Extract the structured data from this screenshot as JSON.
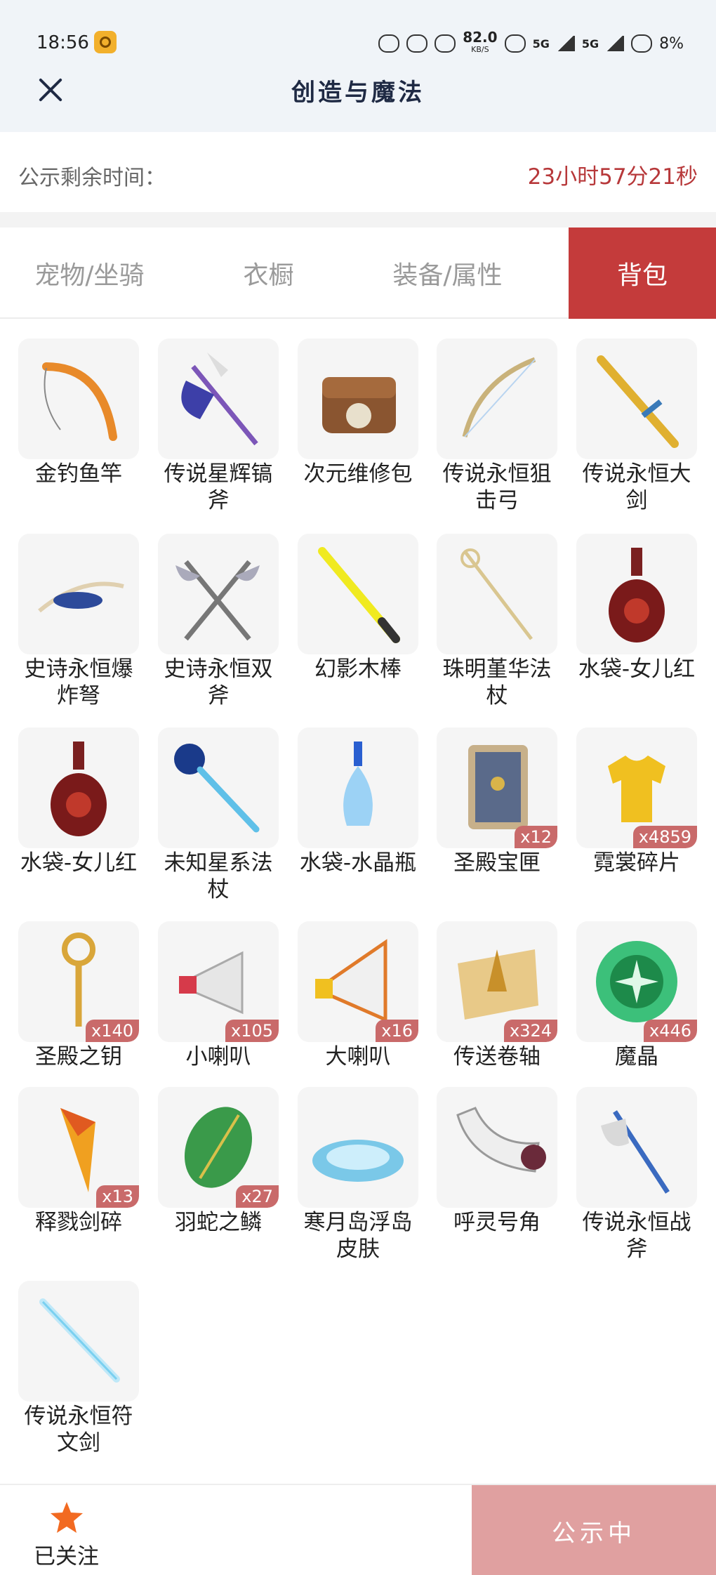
{
  "status_bar": {
    "time": "18:56",
    "speed": "82.0",
    "speed_unit": "KB/S",
    "net1": "5G",
    "net2": "5G",
    "battery": "8%"
  },
  "header": {
    "title": "创造与魔法",
    "close_icon": "close-icon"
  },
  "notice": {
    "label": "公示剩余时间：",
    "remaining": "23小时57分21秒"
  },
  "tabs": [
    {
      "label": "宠物/坐骑",
      "active": false
    },
    {
      "label": "衣橱",
      "active": false
    },
    {
      "label": "装备/属性",
      "active": false
    },
    {
      "label": "背包",
      "active": true
    }
  ],
  "items": [
    {
      "name": "金钓鱼竿",
      "badge": "",
      "icon": "fishing-rod-icon"
    },
    {
      "name": "传说星辉镐斧",
      "badge": "",
      "icon": "axe-icon"
    },
    {
      "name": "次元维修包",
      "badge": "",
      "icon": "repair-bag-icon"
    },
    {
      "name": "传说永恒狙击弓",
      "badge": "",
      "icon": "bow-icon"
    },
    {
      "name": "传说永恒大剑",
      "badge": "",
      "icon": "sword-icon"
    },
    {
      "name": "史诗永恒爆炸弩",
      "badge": "",
      "icon": "crossbow-icon"
    },
    {
      "name": "史诗永恒双斧",
      "badge": "",
      "icon": "double-axe-icon"
    },
    {
      "name": "幻影木棒",
      "badge": "",
      "icon": "stick-icon"
    },
    {
      "name": "珠明堇华法杖",
      "badge": "",
      "icon": "staff-icon"
    },
    {
      "name": "水袋-女儿红",
      "badge": "",
      "icon": "wine-bottle-icon"
    },
    {
      "name": "水袋-女儿红",
      "badge": "",
      "icon": "wine-bottle-icon"
    },
    {
      "name": "未知星系法杖",
      "badge": "",
      "icon": "star-staff-icon"
    },
    {
      "name": "水袋-水晶瓶",
      "badge": "",
      "icon": "crystal-bottle-icon"
    },
    {
      "name": "圣殿宝匣",
      "badge": "x12",
      "icon": "chest-icon"
    },
    {
      "name": "霓裳碎片",
      "badge": "x4859",
      "icon": "shirt-icon"
    },
    {
      "name": "圣殿之钥",
      "badge": "x140",
      "icon": "key-icon"
    },
    {
      "name": "小喇叭",
      "badge": "x105",
      "icon": "megaphone-icon"
    },
    {
      "name": "大喇叭",
      "badge": "x16",
      "icon": "big-megaphone-icon"
    },
    {
      "name": "传送卷轴",
      "badge": "x324",
      "icon": "scroll-icon"
    },
    {
      "name": "魔晶",
      "badge": "x446",
      "icon": "magic-crystal-icon"
    },
    {
      "name": "释戮剑碎",
      "badge": "x13",
      "icon": "sword-shard-icon"
    },
    {
      "name": "羽蛇之鳞",
      "badge": "x27",
      "icon": "scale-icon"
    },
    {
      "name": "寒月岛浮岛皮肤",
      "badge": "",
      "icon": "island-icon"
    },
    {
      "name": "呼灵号角",
      "badge": "",
      "icon": "horn-icon"
    },
    {
      "name": "传说永恒战斧",
      "badge": "",
      "icon": "battle-axe-icon"
    },
    {
      "name": "传说永恒符文剑",
      "badge": "",
      "icon": "rune-sword-icon"
    }
  ],
  "bottom": {
    "follow_label": "已关注",
    "publish_label": "公示中",
    "star_color": "#f26a21"
  }
}
